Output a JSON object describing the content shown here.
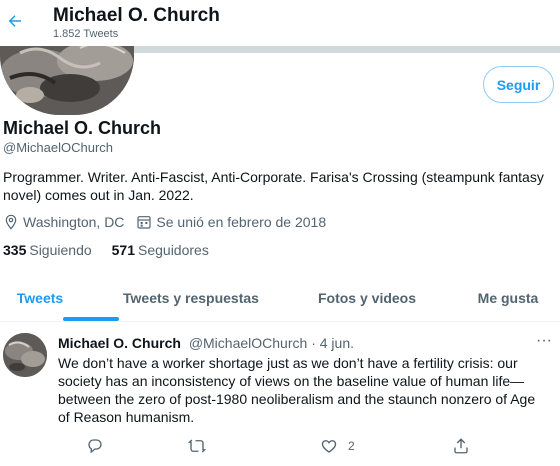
{
  "topbar": {
    "name": "Michael O. Church",
    "tweet_count": "1.852 Tweets"
  },
  "profile": {
    "follow_label": "Seguir",
    "name": "Michael O. Church",
    "handle": "@MichaelOChurch",
    "bio": "Programmer. Writer. Anti-Fascist, Anti-Corporate. Farisa's Crossing (steampunk fantasy novel) comes out in Jan. 2022.",
    "location": "Washington, DC",
    "joined": "Se unió en febrero de 2018",
    "following_count": "335",
    "following_label": "Siguiendo",
    "followers_count": "571",
    "followers_label": "Seguidores"
  },
  "tabs": [
    {
      "label": "Tweets",
      "active": true
    },
    {
      "label": "Tweets y respuestas",
      "active": false
    },
    {
      "label": "Fotos y videos",
      "active": false
    },
    {
      "label": "Me gusta",
      "active": false
    }
  ],
  "tweet": {
    "name": "Michael O. Church",
    "handle": "@MichaelOChurch",
    "separator": "·",
    "date": "4 jun.",
    "more": "···",
    "text": "We don’t have a worker shortage just as we don’t have a fertility crisis: our society has an inconsistency of views on the baseline value of human life— between the zero of post-1980 neoliberalism and the staunch nonzero of Age of Reason humanism.",
    "reply_count": "",
    "retweet_count": "",
    "like_count": "2"
  },
  "icons": {
    "back": "arrow-left-icon",
    "location": "location-pin-icon",
    "calendar": "calendar-icon",
    "reply": "reply-icon",
    "retweet": "retweet-icon",
    "like": "heart-icon",
    "share": "share-icon"
  },
  "colors": {
    "accent": "#1d9bf0",
    "text": "#0f1419",
    "secondary": "#536471"
  }
}
